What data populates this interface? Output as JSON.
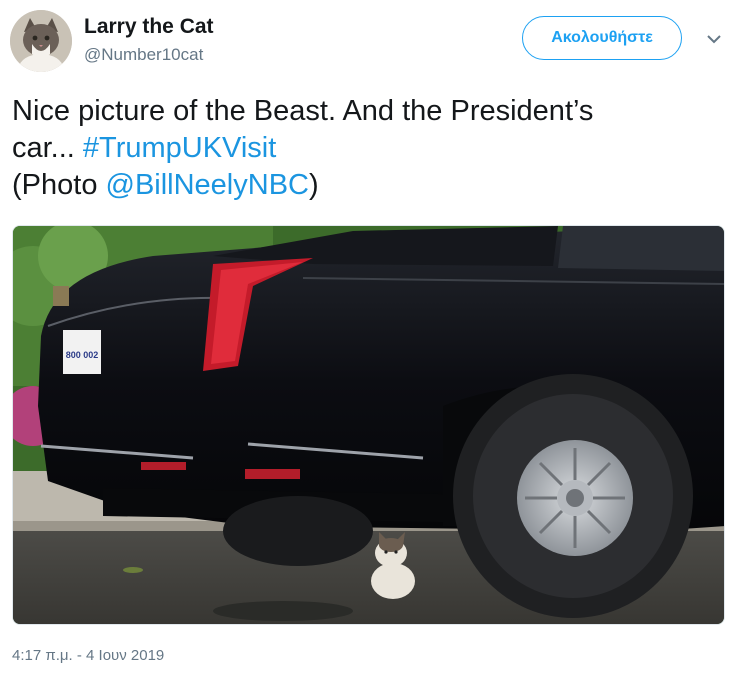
{
  "user": {
    "display_name": "Larry the Cat",
    "handle": "@Number10cat"
  },
  "follow_button": {
    "label": "Ακολουθήστε"
  },
  "tweet": {
    "line1": "Nice picture of the Beast. And the President’s",
    "line2_prefix": "car... ",
    "hashtag": "#TrumpUKVisit",
    "line3_prefix": "(Photo ",
    "mention": "@BillNeelyNBC",
    "line3_suffix": ")"
  },
  "license_plate": "800 002",
  "timestamp": "4:17 π.μ. - 4 Ιουν 2019",
  "colors": {
    "link": "#1b95e0",
    "follow_border": "#1da1f2",
    "secondary_text": "#657786"
  }
}
